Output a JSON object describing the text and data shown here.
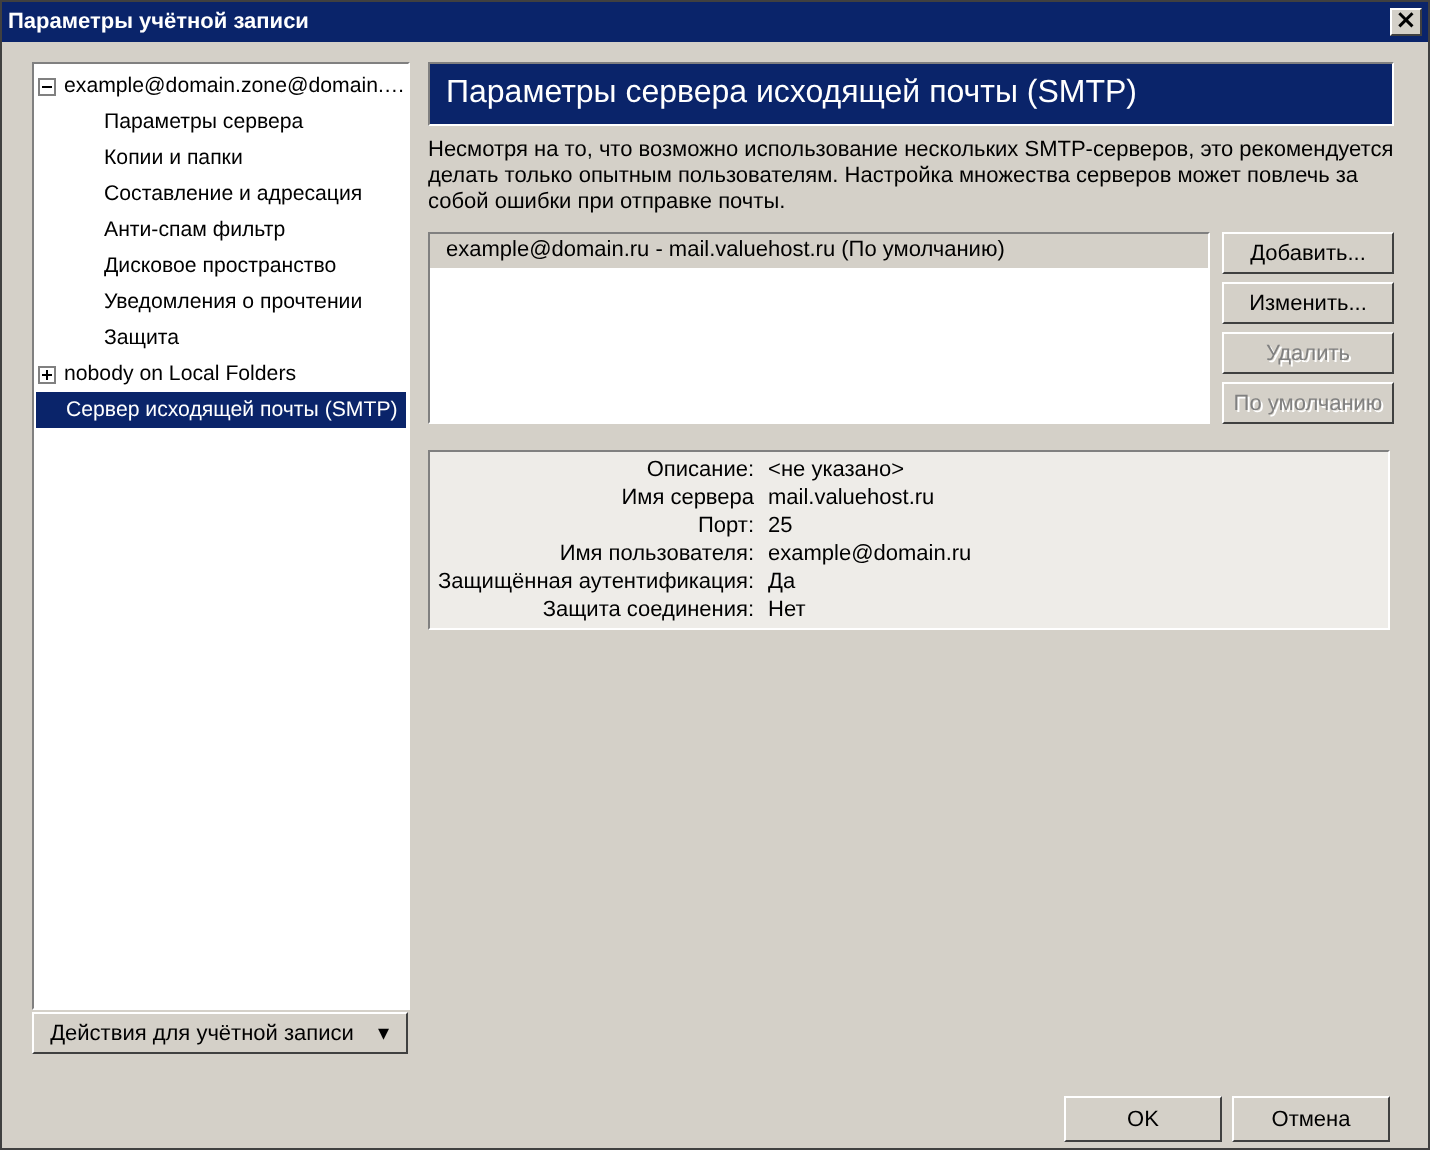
{
  "window": {
    "title": "Параметры учётной записи",
    "close": "×"
  },
  "tree": [
    {
      "label": "example@domain.zone@domain.…",
      "expanded": true,
      "selected": false,
      "children": [
        {
          "label": "Параметры сервера",
          "selected": false
        },
        {
          "label": "Копии и папки",
          "selected": false
        },
        {
          "label": "Составление и адресация",
          "selected": false
        },
        {
          "label": "Анти-спам фильтр",
          "selected": false
        },
        {
          "label": "Дисковое пространство",
          "selected": false
        },
        {
          "label": "Уведомления о прочтении",
          "selected": false
        },
        {
          "label": "Защита",
          "selected": false
        }
      ]
    },
    {
      "label": "nobody on Local Folders",
      "expanded": false,
      "selected": false
    },
    {
      "label": "Сервер исходящей почты (SMTP)",
      "selected": true
    }
  ],
  "account_actions": {
    "label": "Действия для учётной записи",
    "caret": "▾"
  },
  "panel": {
    "title": "Параметры сервера исходящей почты (SMTP)",
    "description": "Несмотря на то, что возможно использование нескольких SMTP-серверов, это рекомендуется делать только опытным пользователям. Настройка множества серверов может повлечь за собой ошибки при отправке почты.",
    "servers": [
      {
        "label": "example@domain.ru - mail.valuehost.ru (По умолчанию)",
        "selected": true
      }
    ],
    "buttons": [
      {
        "label": "Добавить...",
        "disabled": false
      },
      {
        "label": "Изменить...",
        "disabled": false
      },
      {
        "label": "Удалить",
        "disabled": true
      },
      {
        "label": "По умолчанию",
        "disabled": true
      }
    ],
    "details": [
      {
        "label": "Описание:",
        "value": "<не указано>"
      },
      {
        "label": "Имя сервера",
        "value": "mail.valuehost.ru"
      },
      {
        "label": "Порт:",
        "value": "25"
      },
      {
        "label": "Имя пользователя:",
        "value": "example@domain.ru"
      },
      {
        "label": "Защищённая аутентификация:",
        "value": "Да"
      },
      {
        "label": "Защита соединения:",
        "value": "Нет"
      }
    ]
  },
  "dialog_buttons": [
    "OK",
    "Отмена"
  ]
}
